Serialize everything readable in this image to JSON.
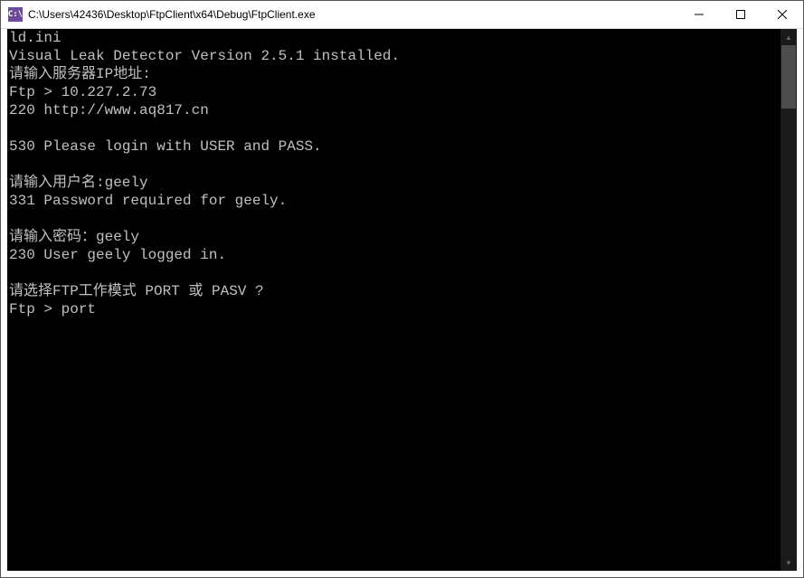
{
  "window": {
    "title": "C:\\Users\\42436\\Desktop\\FtpClient\\x64\\Debug\\FtpClient.exe",
    "icon_label": "C:\\"
  },
  "console": {
    "lines": [
      "ld.ini",
      "Visual Leak Detector Version 2.5.1 installed.",
      "请输入服务器IP地址:",
      "Ftp > 10.227.2.73",
      "220 http://www.aq817.cn",
      "",
      "530 Please login with USER and PASS.",
      "",
      "请输入用户名:geely",
      "331 Password required for geely.",
      "",
      "请输入密码：geely",
      "230 User geely logged in.",
      "",
      "请选择FTP工作模式 PORT 或 PASV ?",
      "Ftp > port"
    ]
  }
}
